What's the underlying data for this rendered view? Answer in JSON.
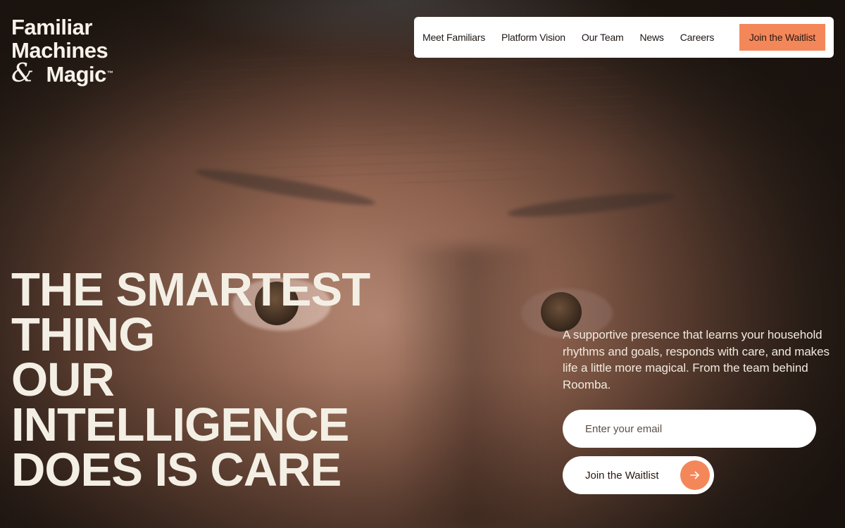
{
  "brand": {
    "line1": "Familiar",
    "line2": "Machines",
    "amp": "&",
    "line3": "Magic",
    "trademark": "™"
  },
  "nav": {
    "items": [
      {
        "label": "Meet Familiars"
      },
      {
        "label": "Platform Vision"
      },
      {
        "label": "Our Team"
      },
      {
        "label": "News"
      },
      {
        "label": "Careers"
      }
    ],
    "cta_label": "Join the Waitlist"
  },
  "hero": {
    "headline_lines": [
      "THE SMARTEST",
      "THING",
      "OUR",
      "INTELLIGENCE",
      "DOES IS CARE"
    ],
    "tagline": "A supportive presence that learns your household rhythms and goals, responds with care, and makes life a little more magical. From the team behind Roomba.",
    "email_placeholder": "Enter your email",
    "submit_label": "Join the Waitlist",
    "submit_icon": "arrow-right-icon"
  },
  "colors": {
    "accent": "#f4875a",
    "text_light": "#f4efe4",
    "nav_bg": "#ffffff"
  }
}
